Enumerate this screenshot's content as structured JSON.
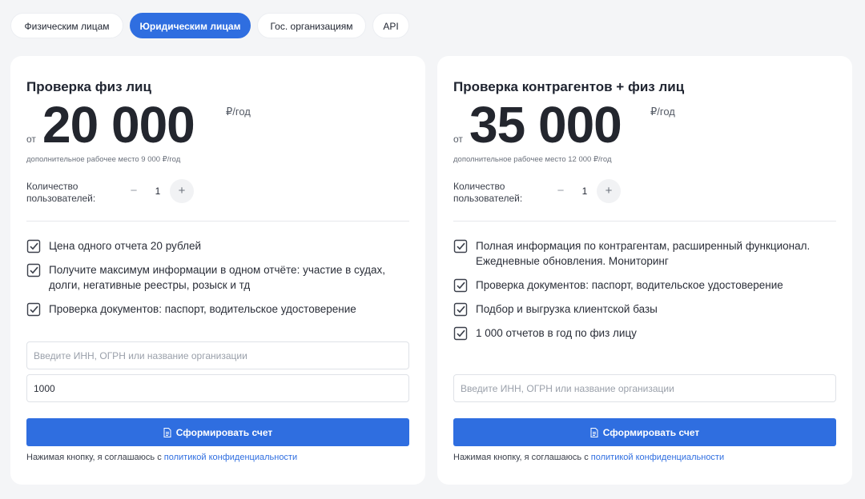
{
  "tabs": [
    {
      "label": "Физическим лицам",
      "active": false
    },
    {
      "label": "Юридическим лицам",
      "active": true
    },
    {
      "label": "Гос. организациям",
      "active": false
    },
    {
      "label": "API",
      "active": false
    }
  ],
  "colors": {
    "accent": "#2f6ee0",
    "background": "#f4f5f7",
    "card": "#ffffff"
  },
  "cards": [
    {
      "title": "Проверка физ лиц",
      "price_from": "от",
      "price": "20 000",
      "price_unit": "₽/год",
      "extra_note": "дополнительное рабочее место 9 000 ₽/год",
      "qty_label": "Количество пользователей:",
      "qty_minus": "−",
      "qty_value": "1",
      "qty_plus": "+",
      "features": [
        "Цена одного отчета 20 рублей",
        "Получите максимум информации в одном отчёте: участие в судах, долги, негативные реестры, розыск и тд",
        "Проверка документов: паспорт, водительское удостоверение"
      ],
      "input_placeholder": "Введите ИНН, ОГРН или название организации",
      "input2_value": "1000",
      "button_label": "Сформировать счет",
      "consent_text": "Нажимая кнопку, я соглашаюсь с ",
      "consent_link": "политикой конфиденциальности"
    },
    {
      "title": "Проверка контрагентов + физ лиц",
      "price_from": "от",
      "price": "35 000",
      "price_unit": "₽/год",
      "extra_note": "дополнительное рабочее место 12 000 ₽/год",
      "qty_label": "Количество пользователей:",
      "qty_minus": "−",
      "qty_value": "1",
      "qty_plus": "+",
      "features": [
        "Полная информация по контрагентам, расширенный функционал. Ежедневные обновления. Мониторинг",
        "Проверка документов: паспорт, водительское удостоверение",
        "Подбор и выгрузка клиентской базы",
        "1 000 отчетов в год по физ лицу"
      ],
      "input_placeholder": "Введите ИНН, ОГРН или название организации",
      "button_label": "Сформировать счет",
      "consent_text": "Нажимая кнопку, я соглашаюсь с ",
      "consent_link": "политикой конфиденциальности"
    }
  ]
}
